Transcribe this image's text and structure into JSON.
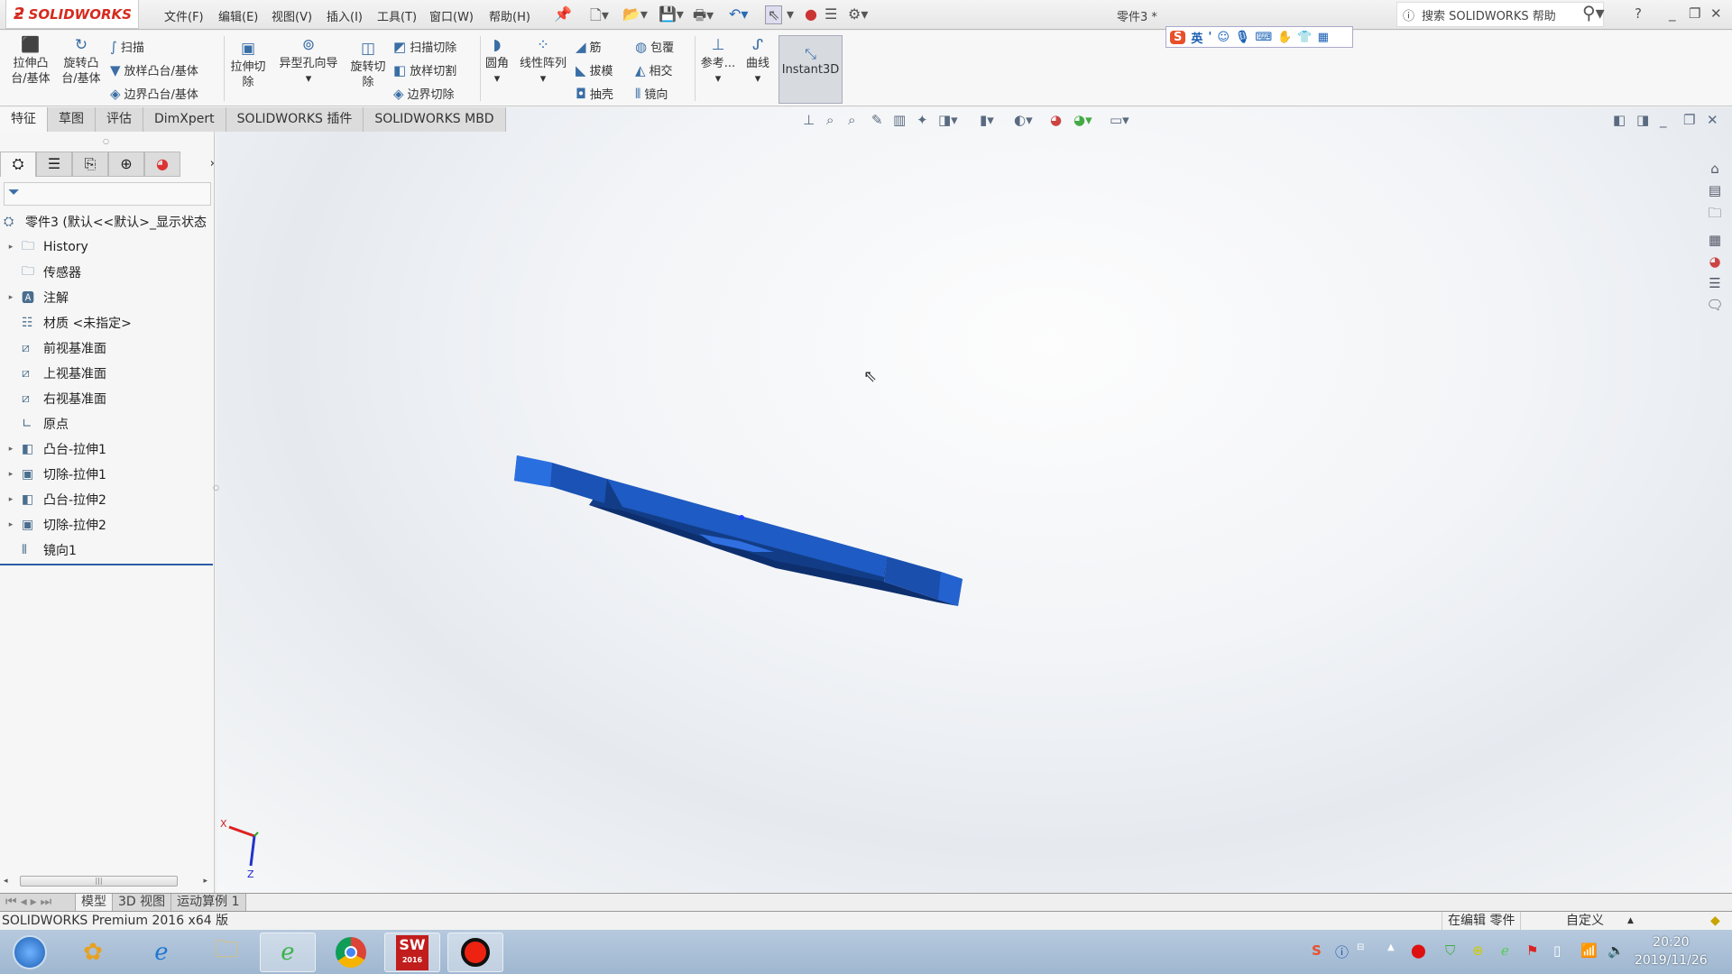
{
  "app": {
    "logo": "SOLIDWORKS",
    "document_title": "零件3 *",
    "search_placeholder": "搜索 SOLIDWORKS 帮助",
    "help": "?"
  },
  "menu": [
    "文件(F)",
    "编辑(E)",
    "视图(V)",
    "插入(I)",
    "工具(T)",
    "窗口(W)",
    "帮助(H)"
  ],
  "ime": {
    "logo": "S",
    "mode": "英",
    "punct": "'"
  },
  "ribbon": {
    "extrude_boss": "拉伸凸台/基体",
    "revolve_boss": "旋转凸台/基体",
    "sweep": "扫描",
    "loft_boss": "放样凸台/基体",
    "boundary_boss": "边界凸台/基体",
    "extrude_cut": "拉伸切除",
    "hole_wizard": "异型孔向导",
    "revolve_cut": "旋转切除",
    "swept_cut": "扫描切除",
    "lofted_cut": "放样切割",
    "boundary_cut": "边界切除",
    "fillet": "圆角",
    "linear_pattern": "线性阵列",
    "rib": "筋",
    "draft": "拔模",
    "shell": "抽壳",
    "wrap": "包覆",
    "intersect": "相交",
    "mirror": "镜向",
    "reference": "参考...",
    "curves": "曲线",
    "instant3d": "Instant3D"
  },
  "tabs": [
    "特征",
    "草图",
    "评估",
    "DimXpert",
    "SOLIDWORKS 插件",
    "SOLIDWORKS MBD"
  ],
  "tree": {
    "root": "零件3 (默认<<默认>_显示状态",
    "items": [
      {
        "label": "History",
        "expandable": true,
        "icon": "history-folder-icon"
      },
      {
        "label": "传感器",
        "expandable": false,
        "icon": "sensor-folder-icon"
      },
      {
        "label": "注解",
        "expandable": true,
        "icon": "annotation-folder-icon"
      },
      {
        "label": "材质 <未指定>",
        "expandable": false,
        "icon": "material-icon"
      },
      {
        "label": "前视基准面",
        "expandable": false,
        "icon": "plane-icon"
      },
      {
        "label": "上视基准面",
        "expandable": false,
        "icon": "plane-icon"
      },
      {
        "label": "右视基准面",
        "expandable": false,
        "icon": "plane-icon"
      },
      {
        "label": "原点",
        "expandable": false,
        "icon": "origin-icon"
      },
      {
        "label": "凸台-拉伸1",
        "expandable": true,
        "icon": "boss-extrude-icon"
      },
      {
        "label": "切除-拉伸1",
        "expandable": true,
        "icon": "cut-extrude-icon"
      },
      {
        "label": "凸台-拉伸2",
        "expandable": true,
        "icon": "boss-extrude-icon"
      },
      {
        "label": "切除-拉伸2",
        "expandable": true,
        "icon": "cut-extrude-icon"
      },
      {
        "label": "镜向1",
        "expandable": false,
        "icon": "mirror-icon"
      }
    ]
  },
  "triad": {
    "x": "X",
    "z": "Z"
  },
  "bottom_tabs": [
    "模型",
    "3D 视图",
    "运动算例 1"
  ],
  "status": {
    "product": "SOLIDWORKS Premium 2016 x64 版",
    "editing": "在编辑 零件",
    "units": "自定义"
  },
  "taskbar": {
    "time": "20:20",
    "date": "2019/11/26",
    "sw_badge": "2016"
  },
  "colors": {
    "part": "#1f5fc8",
    "brand": "#d52b1e"
  }
}
